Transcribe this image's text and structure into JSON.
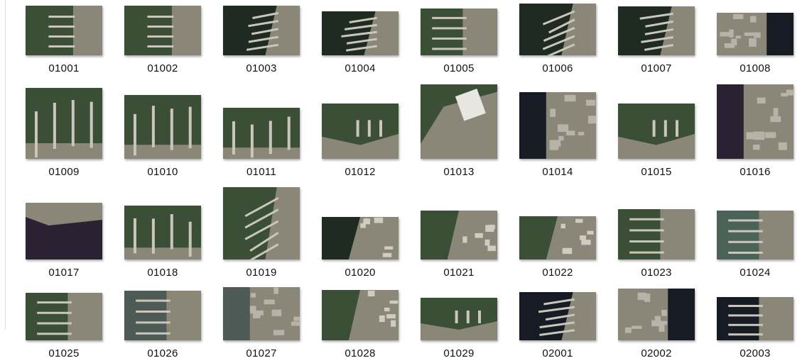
{
  "thumbnail_view": {
    "items": [
      {
        "name": "01001",
        "tone": "green",
        "variant": "left-piers"
      },
      {
        "name": "01002",
        "tone": "green",
        "variant": "left-piers"
      },
      {
        "name": "01003",
        "tone": "dark",
        "variant": "diag-piers"
      },
      {
        "name": "01004",
        "tone": "dark",
        "variant": "diag-piers"
      },
      {
        "name": "01005",
        "tone": "green",
        "variant": "long-piers"
      },
      {
        "name": "01006",
        "tone": "dark",
        "variant": "fan-piers"
      },
      {
        "name": "01007",
        "tone": "dark",
        "variant": "diag-piers"
      },
      {
        "name": "01008",
        "tone": "navy",
        "variant": "city-left"
      },
      {
        "name": "01009",
        "tone": "green",
        "variant": "vertical-piers"
      },
      {
        "name": "01010",
        "tone": "green",
        "variant": "vertical-piers"
      },
      {
        "name": "01011",
        "tone": "green",
        "variant": "vertical-piers"
      },
      {
        "name": "01012",
        "tone": "green",
        "variant": "shore-bottom"
      },
      {
        "name": "01013",
        "tone": "green",
        "variant": "big-building"
      },
      {
        "name": "01014",
        "tone": "navy",
        "variant": "industrial"
      },
      {
        "name": "01015",
        "tone": "green",
        "variant": "shore-bottom"
      },
      {
        "name": "01016",
        "tone": "purple",
        "variant": "city-bay"
      },
      {
        "name": "01017",
        "tone": "purple",
        "variant": "coast-top"
      },
      {
        "name": "01018",
        "tone": "green",
        "variant": "vertical-piers"
      },
      {
        "name": "01019",
        "tone": "green",
        "variant": "fan-piers"
      },
      {
        "name": "01020",
        "tone": "dark",
        "variant": "yard-right"
      },
      {
        "name": "01021",
        "tone": "green",
        "variant": "yard-right"
      },
      {
        "name": "01022",
        "tone": "green",
        "variant": "yard-right"
      },
      {
        "name": "01023",
        "tone": "green",
        "variant": "long-piers"
      },
      {
        "name": "01024",
        "tone": "teal",
        "variant": "long-piers"
      },
      {
        "name": "01025",
        "tone": "green",
        "variant": "long-piers"
      },
      {
        "name": "01026",
        "tone": "gray",
        "variant": "long-piers"
      },
      {
        "name": "01027",
        "tone": "gray",
        "variant": "city-bay"
      },
      {
        "name": "01028",
        "tone": "green",
        "variant": "yard-right"
      },
      {
        "name": "01029",
        "tone": "green",
        "variant": "shore-bottom"
      },
      {
        "name": "02001",
        "tone": "navy",
        "variant": "diag-piers"
      },
      {
        "name": "02002",
        "tone": "navy",
        "variant": "city-left"
      },
      {
        "name": "02003",
        "tone": "navy",
        "variant": "long-piers"
      }
    ]
  },
  "colors": {
    "green": "#3b4f37",
    "dark": "#1f2b22",
    "navy": "#161b24",
    "purple": "#2a2233",
    "teal": "#4a6257",
    "gray": "#4d5a55",
    "land": "#8a8678",
    "pier": "#c9c6bc"
  }
}
